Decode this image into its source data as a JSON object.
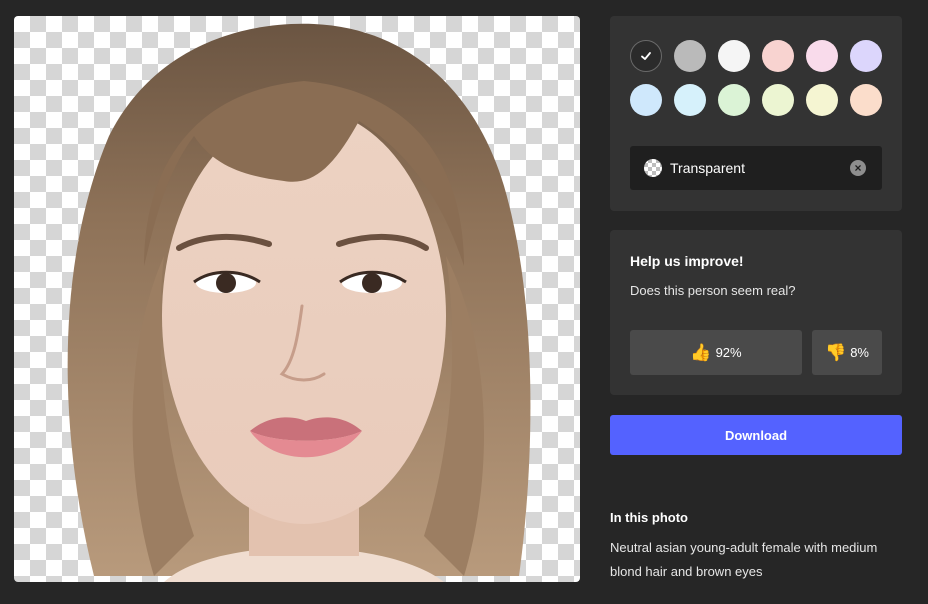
{
  "photo": {
    "name": "portrait-photo"
  },
  "colors": {
    "swatches": [
      {
        "name": "transparent",
        "color": "#2b2b2b",
        "selected": true
      },
      {
        "name": "gray",
        "color": "#bababa"
      },
      {
        "name": "white",
        "color": "#f5f5f5"
      },
      {
        "name": "pink",
        "color": "#f8d3d0"
      },
      {
        "name": "rose",
        "color": "#f9dbeb"
      },
      {
        "name": "lavender",
        "color": "#dcd6fc"
      },
      {
        "name": "light-blue",
        "color": "#cfe8fc"
      },
      {
        "name": "sky",
        "color": "#d6f1fb"
      },
      {
        "name": "mint",
        "color": "#dbf3d6"
      },
      {
        "name": "lime",
        "color": "#ecf5d2"
      },
      {
        "name": "cream",
        "color": "#f5f5d2"
      },
      {
        "name": "peach",
        "color": "#fbddcb"
      }
    ],
    "selected_icon": "check-icon",
    "background_value": "Transparent",
    "clear_icon": "clear-icon"
  },
  "feedback": {
    "title": "Help us improve!",
    "question": "Does this person seem real?",
    "yes_emoji": "👍",
    "yes_percent": "92%",
    "no_emoji": "👎",
    "no_percent": "8%"
  },
  "download_label": "Download",
  "info": {
    "title": "In this photo",
    "description": "Neutral asian young-adult female with medium blond hair and brown eyes"
  },
  "accent": "#5462ff"
}
